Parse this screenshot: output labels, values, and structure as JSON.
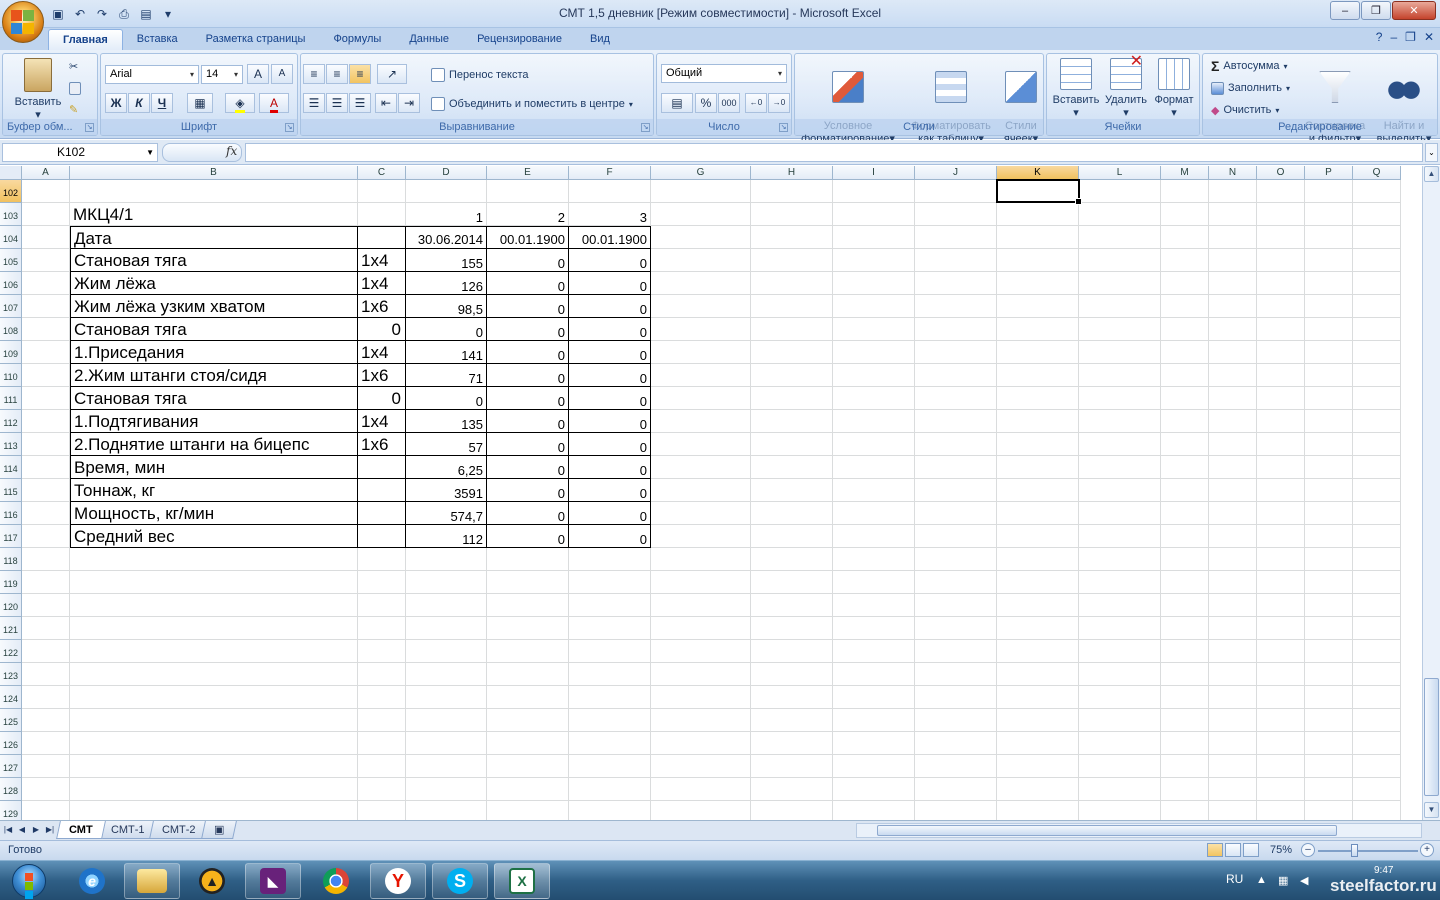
{
  "window": {
    "title": "СМТ 1,5 дневник  [Режим совместимости] - Microsoft Excel",
    "minimize": "–",
    "restore": "❐",
    "close": "✕"
  },
  "ribbon_tabs": [
    "Главная",
    "Вставка",
    "Разметка страницы",
    "Формулы",
    "Данные",
    "Рецензирование",
    "Вид"
  ],
  "active_tab": "Главная",
  "ribbon": {
    "clipboard": {
      "paste": "Вставить",
      "label": "Буфер обм..."
    },
    "font": {
      "name": "Arial",
      "size": "14",
      "bold": "Ж",
      "italic": "К",
      "underline": "Ч",
      "grow": "A",
      "shrink": "A",
      "color_a": "A",
      "label": "Шрифт"
    },
    "alignment": {
      "wrap": "Перенос текста",
      "merge": "Объединить и поместить в центре",
      "label": "Выравнивание"
    },
    "number": {
      "format": "Общий",
      "percent": "%",
      "thousands": "000",
      "label": "Число"
    },
    "styles": {
      "conditional": "Условное\nформатирование",
      "as_table": "Форматировать\nкак таблицу",
      "cell_styles": "Стили\nячеек",
      "label": "Стили"
    },
    "cells": {
      "insert": "Вставить",
      "delete": "Удалить",
      "format": "Формат",
      "label": "Ячейки"
    },
    "editing": {
      "autosum": "Автосумма",
      "fill": "Заполнить",
      "clear": "Очистить",
      "sort": "Сортировка\nи фильтр",
      "find": "Найти и\nвыделить",
      "label": "Редактирование"
    }
  },
  "formula_bar": {
    "name_box": "K102",
    "fx": "fx",
    "content": ""
  },
  "columns": [
    "A",
    "B",
    "C",
    "D",
    "E",
    "F",
    "G",
    "H",
    "I",
    "J",
    "K",
    "L",
    "M",
    "N",
    "O",
    "P",
    "Q"
  ],
  "selected_column": "K",
  "rows": [
    "102",
    "103",
    "104",
    "105",
    "106",
    "107",
    "108",
    "109",
    "110",
    "111",
    "112",
    "113",
    "114",
    "115",
    "116",
    "117",
    "118",
    "119",
    "120",
    "121",
    "122",
    "123",
    "124",
    "125",
    "126",
    "127",
    "128",
    "129"
  ],
  "selected_row": "102",
  "sheet": {
    "title": "МКЦ4/1",
    "col_numbers": [
      "1",
      "2",
      "3"
    ],
    "table": [
      {
        "label": "Дата",
        "reps": "",
        "d": "30.06.2014",
        "e": "00.01.1900",
        "f": "00.01.1900"
      },
      {
        "label": "Становая тяга",
        "reps": "1х4",
        "d": "155",
        "e": "0",
        "f": "0"
      },
      {
        "label": "Жим лёжа",
        "reps": "1х4",
        "d": "126",
        "e": "0",
        "f": "0"
      },
      {
        "label": "Жим лёжа узким хватом",
        "reps": "1х6",
        "d": "98,5",
        "e": "0",
        "f": "0"
      },
      {
        "label": "Становая тяга",
        "reps": "0",
        "d": "0",
        "e": "0",
        "f": "0"
      },
      {
        "label": "1.Приседания",
        "reps": "1х4",
        "d": "141",
        "e": "0",
        "f": "0"
      },
      {
        "label": "2.Жим штанги стоя/сидя",
        "reps": "1х6",
        "d": "71",
        "e": "0",
        "f": "0"
      },
      {
        "label": "Становая тяга",
        "reps": "0",
        "d": "0",
        "e": "0",
        "f": "0"
      },
      {
        "label": "1.Подтягивания",
        "reps": "1х4",
        "d": "135",
        "e": "0",
        "f": "0"
      },
      {
        "label": "2.Поднятие штанги на бицепс",
        "reps": "1х6",
        "d": "57",
        "e": "0",
        "f": "0"
      },
      {
        "label": "Время, мин",
        "reps": "",
        "d": "6,25",
        "e": "0",
        "f": "0"
      },
      {
        "label": "Тоннаж, кг",
        "reps": "",
        "d": "3591",
        "e": "0",
        "f": "0"
      },
      {
        "label": "Мощность, кг/мин",
        "reps": "",
        "d": "574,7",
        "e": "0",
        "f": "0"
      },
      {
        "label": "Средний вес",
        "reps": "",
        "d": "112",
        "e": "0",
        "f": "0"
      }
    ]
  },
  "sheet_tabs": [
    "СМТ",
    "СМТ-1",
    "СМТ-2"
  ],
  "active_sheet": "СМТ",
  "status": {
    "text": "Готово",
    "zoom": "75%",
    "zoom_minus": "–",
    "zoom_plus": "+"
  },
  "taskbar": {
    "lang": "RU",
    "clock": "9:47",
    "watermark": "steelfactor.ru"
  },
  "colors": {
    "accent": "#15428b",
    "selection_header": "#f1c15f",
    "excel_green": "#1d7044"
  }
}
